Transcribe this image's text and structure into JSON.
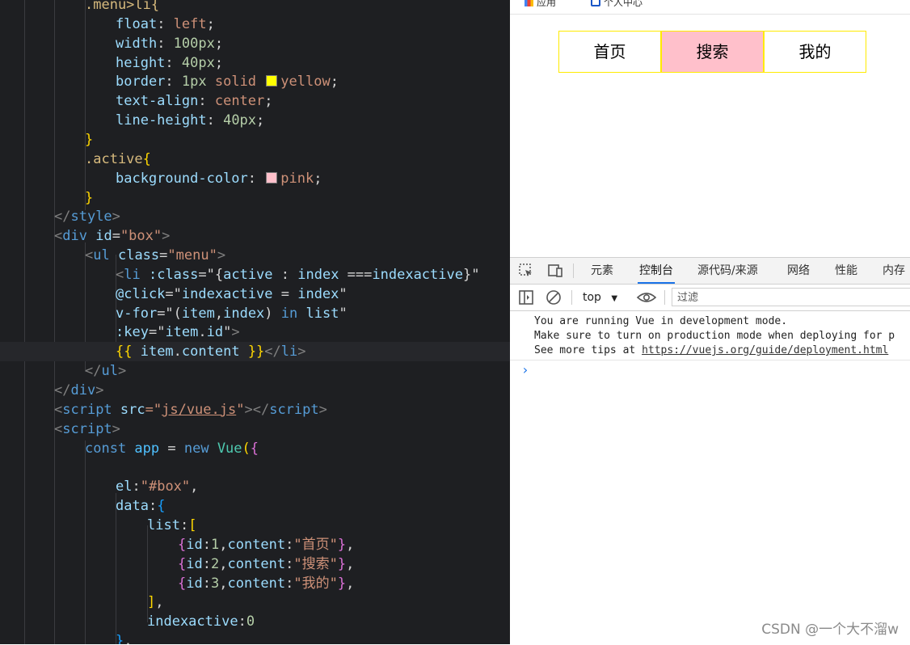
{
  "editor": {
    "lines": [
      [
        {
          "t": ".menu>li{",
          "c": "t-sel"
        }
      ],
      [
        {
          "t": "float",
          "c": "t-prop"
        },
        {
          "t": ": ",
          "c": "t-punc"
        },
        {
          "t": "left",
          "c": "t-val"
        },
        {
          "t": ";",
          "c": "t-punc"
        }
      ],
      [
        {
          "t": "width",
          "c": "t-prop"
        },
        {
          "t": ": ",
          "c": "t-punc"
        },
        {
          "t": "100px",
          "c": "t-num"
        },
        {
          "t": ";",
          "c": "t-punc"
        }
      ],
      [
        {
          "t": "height",
          "c": "t-prop"
        },
        {
          "t": ": ",
          "c": "t-punc"
        },
        {
          "t": "40px",
          "c": "t-num"
        },
        {
          "t": ";",
          "c": "t-punc"
        }
      ],
      [
        {
          "t": "border",
          "c": "t-prop"
        },
        {
          "t": ": ",
          "c": "t-punc"
        },
        {
          "t": "1px",
          "c": "t-num"
        },
        {
          "t": " solid ",
          "c": "t-val"
        },
        {
          "sw": "#ffff00"
        },
        {
          "t": "yellow",
          "c": "t-val"
        },
        {
          "t": ";",
          "c": "t-punc"
        }
      ],
      [
        {
          "t": "text-align",
          "c": "t-prop"
        },
        {
          "t": ": ",
          "c": "t-punc"
        },
        {
          "t": "center",
          "c": "t-val"
        },
        {
          "t": ";",
          "c": "t-punc"
        }
      ],
      [
        {
          "t": "line-height",
          "c": "t-prop"
        },
        {
          "t": ": ",
          "c": "t-punc"
        },
        {
          "t": "40px",
          "c": "t-num"
        },
        {
          "t": ";",
          "c": "t-punc"
        }
      ],
      [
        {
          "t": "}",
          "c": "t-br1"
        }
      ],
      [
        {
          "t": ".active",
          "c": "t-sel"
        },
        {
          "t": "{",
          "c": "t-br1"
        }
      ],
      [
        {
          "t": "background-color",
          "c": "t-prop"
        },
        {
          "t": ": ",
          "c": "t-punc"
        },
        {
          "sw": "#ffc0cb"
        },
        {
          "t": "pink",
          "c": "t-val"
        },
        {
          "t": ";",
          "c": "t-punc"
        }
      ],
      [
        {
          "t": "}",
          "c": "t-br1"
        }
      ],
      [
        {
          "t": "</",
          "c": "t-tagb"
        },
        {
          "t": "style",
          "c": "t-tag"
        },
        {
          "t": ">",
          "c": "t-tagb"
        }
      ],
      [
        {
          "t": "<",
          "c": "t-tagb"
        },
        {
          "t": "div",
          "c": "t-tag"
        },
        {
          "t": " id",
          "c": "t-attr"
        },
        {
          "t": "=",
          "c": "t-punc"
        },
        {
          "t": "\"box\"",
          "c": "t-str"
        },
        {
          "t": ">",
          "c": "t-tagb"
        }
      ],
      [
        {
          "t": "<",
          "c": "t-tagb"
        },
        {
          "t": "ul",
          "c": "t-tag"
        },
        {
          "t": " class",
          "c": "t-attr"
        },
        {
          "t": "=",
          "c": "t-punc"
        },
        {
          "t": "\"menu\"",
          "c": "t-str"
        },
        {
          "t": ">",
          "c": "t-tagb"
        }
      ],
      [
        {
          "t": "<",
          "c": "t-tagb"
        },
        {
          "t": "li",
          "c": "t-tag"
        },
        {
          "t": " :class",
          "c": "t-attr"
        },
        {
          "t": "=\"{",
          "c": "t-punc"
        },
        {
          "t": "active",
          "c": "t-key"
        },
        {
          "t": " : ",
          "c": "t-punc"
        },
        {
          "t": "index",
          "c": "t-key"
        },
        {
          "t": " ===",
          "c": "t-punc"
        },
        {
          "t": "indexactive",
          "c": "t-key"
        },
        {
          "t": "}\"",
          "c": "t-punc"
        }
      ],
      [
        {
          "t": "@click",
          "c": "t-attr"
        },
        {
          "t": "=\"",
          "c": "t-punc"
        },
        {
          "t": "indexactive",
          "c": "t-key"
        },
        {
          "t": " = ",
          "c": "t-punc"
        },
        {
          "t": "index",
          "c": "t-key"
        },
        {
          "t": "\"",
          "c": "t-punc"
        }
      ],
      [
        {
          "t": "v-for",
          "c": "t-attr"
        },
        {
          "t": "=\"(",
          "c": "t-punc"
        },
        {
          "t": "item",
          "c": "t-key"
        },
        {
          "t": ",",
          "c": "t-punc"
        },
        {
          "t": "index",
          "c": "t-key"
        },
        {
          "t": ") ",
          "c": "t-punc"
        },
        {
          "t": "in",
          "c": "t-kw"
        },
        {
          "t": " ",
          "c": "t-punc"
        },
        {
          "t": "list",
          "c": "t-key"
        },
        {
          "t": "\"",
          "c": "t-punc"
        }
      ],
      [
        {
          "t": ":key",
          "c": "t-attr"
        },
        {
          "t": "=\"",
          "c": "t-punc"
        },
        {
          "t": "item",
          "c": "t-key"
        },
        {
          "t": ".",
          "c": "t-punc"
        },
        {
          "t": "id",
          "c": "t-key"
        },
        {
          "t": "\"",
          "c": "t-punc"
        },
        {
          "t": ">",
          "c": "t-tagb"
        }
      ],
      [
        {
          "t": "{{",
          "c": "t-br1"
        },
        {
          "t": " item",
          "c": "t-key"
        },
        {
          "t": ".",
          "c": "t-punc"
        },
        {
          "t": "content",
          "c": "t-key"
        },
        {
          "t": " }}",
          "c": "t-br1"
        },
        {
          "t": "</",
          "c": "t-tagb"
        },
        {
          "t": "li",
          "c": "t-tag"
        },
        {
          "t": ">",
          "c": "t-tagb"
        }
      ],
      [
        {
          "t": "</",
          "c": "t-tagb"
        },
        {
          "t": "ul",
          "c": "t-tag"
        },
        {
          "t": ">",
          "c": "t-tagb"
        }
      ],
      [
        {
          "t": "</",
          "c": "t-tagb"
        },
        {
          "t": "div",
          "c": "t-tag"
        },
        {
          "t": ">",
          "c": "t-tagb"
        }
      ],
      [
        {
          "t": "<",
          "c": "t-tagb"
        },
        {
          "t": "script",
          "c": "t-tag"
        },
        {
          "t": " src",
          "c": "t-attr"
        },
        {
          "t": "=\"",
          "c": "t-str"
        },
        {
          "t": "js/vue.js",
          "c": "t-str u"
        },
        {
          "t": "\"",
          "c": "t-str"
        },
        {
          "t": "></",
          "c": "t-tagb"
        },
        {
          "t": "script",
          "c": "t-tag"
        },
        {
          "t": ">",
          "c": "t-tagb"
        }
      ],
      [
        {
          "t": "<",
          "c": "t-tagb"
        },
        {
          "t": "script",
          "c": "t-tag"
        },
        {
          "t": ">",
          "c": "t-tagb"
        }
      ],
      [
        {
          "t": "const",
          "c": "t-kw"
        },
        {
          "t": " app",
          "c": "t-var"
        },
        {
          "t": " = ",
          "c": "t-punc"
        },
        {
          "t": "new",
          "c": "t-kw"
        },
        {
          "t": " Vue",
          "c": "t-cls"
        },
        {
          "t": "(",
          "c": "t-br1"
        },
        {
          "t": "{",
          "c": "t-br2"
        }
      ],
      [],
      [
        {
          "t": "el",
          "c": "t-key"
        },
        {
          "t": ":",
          "c": "t-punc"
        },
        {
          "t": "\"#box\"",
          "c": "t-str"
        },
        {
          "t": ",",
          "c": "t-punc"
        }
      ],
      [
        {
          "t": "data",
          "c": "t-key"
        },
        {
          "t": ":",
          "c": "t-punc"
        },
        {
          "t": "{",
          "c": "t-br3"
        }
      ],
      [
        {
          "t": "list",
          "c": "t-key"
        },
        {
          "t": ":",
          "c": "t-punc"
        },
        {
          "t": "[",
          "c": "t-br1"
        }
      ],
      [
        {
          "t": "{",
          "c": "t-br2"
        },
        {
          "t": "id",
          "c": "t-key"
        },
        {
          "t": ":",
          "c": "t-punc"
        },
        {
          "t": "1",
          "c": "t-num"
        },
        {
          "t": ",",
          "c": "t-punc"
        },
        {
          "t": "content",
          "c": "t-key"
        },
        {
          "t": ":",
          "c": "t-punc"
        },
        {
          "t": "\"首页\"",
          "c": "t-str"
        },
        {
          "t": "}",
          "c": "t-br2"
        },
        {
          "t": ",",
          "c": "t-punc"
        }
      ],
      [
        {
          "t": "{",
          "c": "t-br2"
        },
        {
          "t": "id",
          "c": "t-key"
        },
        {
          "t": ":",
          "c": "t-punc"
        },
        {
          "t": "2",
          "c": "t-num"
        },
        {
          "t": ",",
          "c": "t-punc"
        },
        {
          "t": "content",
          "c": "t-key"
        },
        {
          "t": ":",
          "c": "t-punc"
        },
        {
          "t": "\"搜索\"",
          "c": "t-str"
        },
        {
          "t": "}",
          "c": "t-br2"
        },
        {
          "t": ",",
          "c": "t-punc"
        }
      ],
      [
        {
          "t": "{",
          "c": "t-br2"
        },
        {
          "t": "id",
          "c": "t-key"
        },
        {
          "t": ":",
          "c": "t-punc"
        },
        {
          "t": "3",
          "c": "t-num"
        },
        {
          "t": ",",
          "c": "t-punc"
        },
        {
          "t": "content",
          "c": "t-key"
        },
        {
          "t": ":",
          "c": "t-punc"
        },
        {
          "t": "\"我的\"",
          "c": "t-str"
        },
        {
          "t": "}",
          "c": "t-br2"
        },
        {
          "t": ",",
          "c": "t-punc"
        }
      ],
      [
        {
          "t": "]",
          "c": "t-br1"
        },
        {
          "t": ",",
          "c": "t-punc"
        }
      ],
      [
        {
          "t": "indexactive",
          "c": "t-key"
        },
        {
          "t": ":",
          "c": "t-punc"
        },
        {
          "t": "0",
          "c": "t-num"
        }
      ],
      [
        {
          "t": "}",
          "c": "t-br3"
        },
        {
          "t": ",",
          "c": "t-punc"
        }
      ]
    ]
  },
  "browser": {
    "bookmarks": [
      "应用",
      "个人中心"
    ],
    "menu": [
      {
        "id": 1,
        "content": "首页",
        "active": false
      },
      {
        "id": 2,
        "content": "搜索",
        "active": true
      },
      {
        "id": 3,
        "content": "我的",
        "active": false
      }
    ],
    "colors": {
      "border": "#ffeb00",
      "active": "#ffc0cb"
    }
  },
  "devtools": {
    "tabs": [
      "元素",
      "控制台",
      "源代码/来源",
      "网络",
      "性能",
      "内存"
    ],
    "selected_tab": "控制台",
    "context": "top",
    "filter_placeholder": "过滤",
    "messages": [
      "You are running Vue in development mode.",
      "Make sure to turn on production mode when deploying for p",
      "See more tips at "
    ],
    "link": "https://vuejs.org/guide/deployment.html",
    "prompt": "›"
  },
  "watermark": "CSDN @一个大不溜w"
}
